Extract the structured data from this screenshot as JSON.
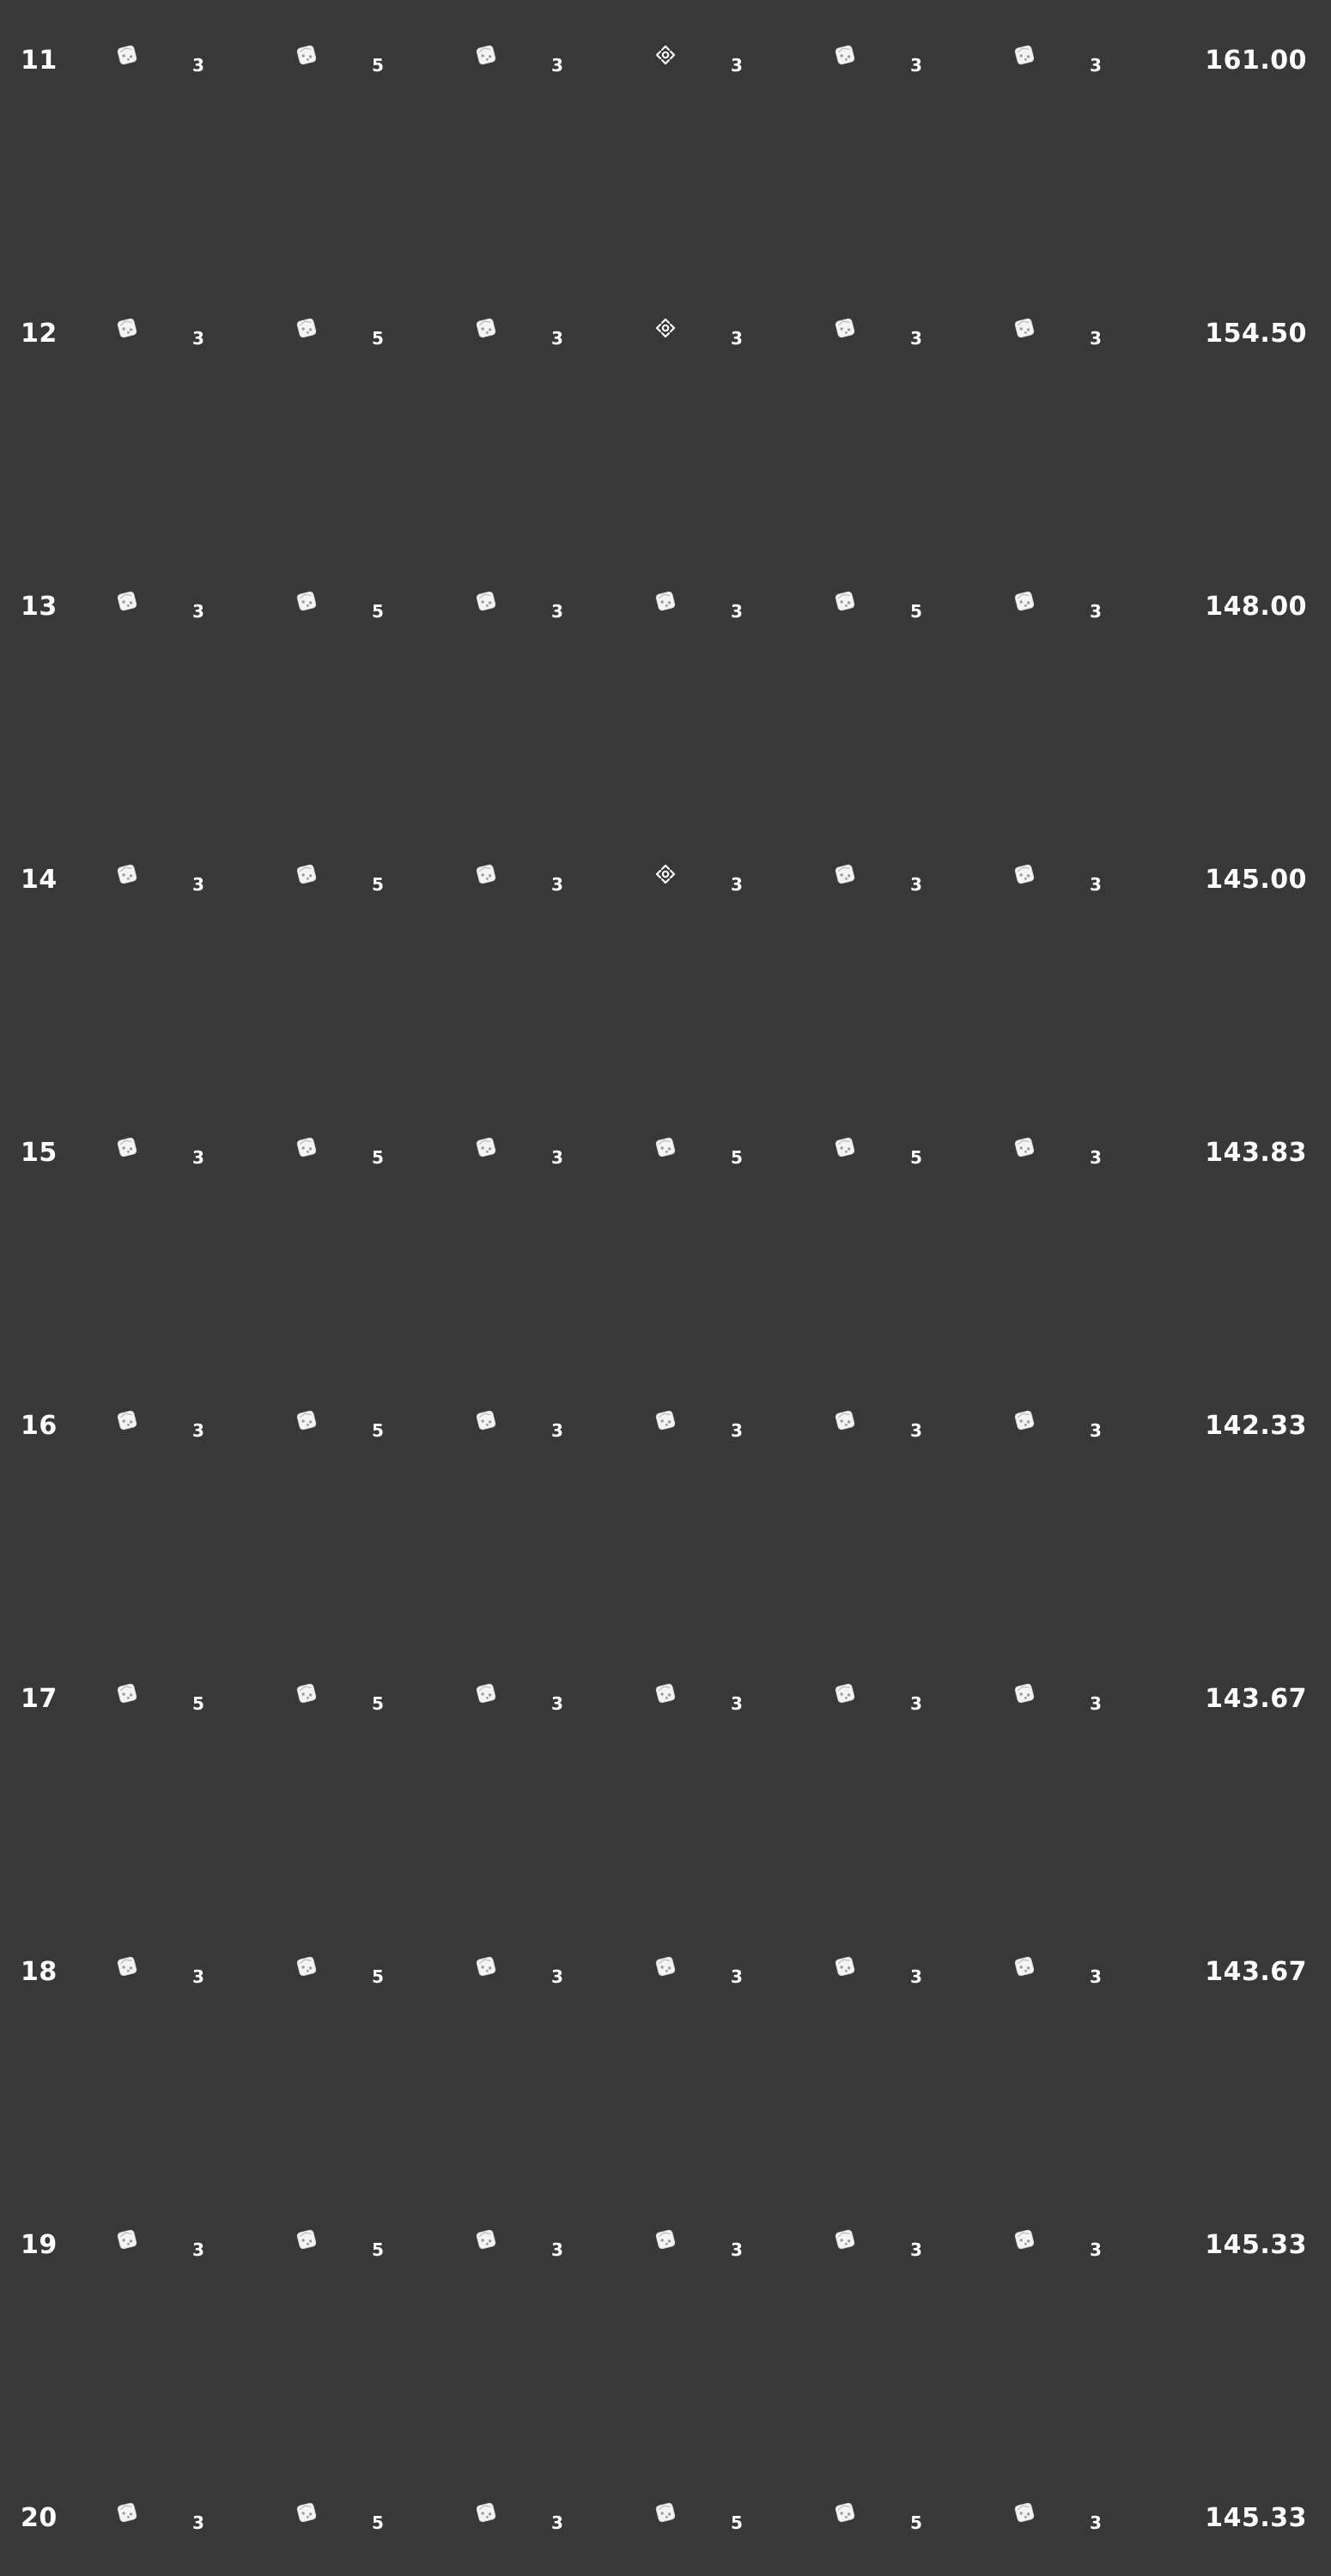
{
  "rows": [
    {
      "index": "11",
      "cells": [
        {
          "icon": "die-icon",
          "value": "3"
        },
        {
          "icon": "die-icon",
          "value": "5"
        },
        {
          "icon": "die-icon",
          "value": "3"
        },
        {
          "icon": "move-arrows-icon",
          "value": "3"
        },
        {
          "icon": "die-icon",
          "value": "3"
        },
        {
          "icon": "die-icon",
          "value": "3"
        }
      ],
      "total": "161.00"
    },
    {
      "index": "12",
      "cells": [
        {
          "icon": "die-icon",
          "value": "3"
        },
        {
          "icon": "die-icon",
          "value": "5"
        },
        {
          "icon": "die-icon",
          "value": "3"
        },
        {
          "icon": "move-arrows-icon",
          "value": "3"
        },
        {
          "icon": "die-icon",
          "value": "3"
        },
        {
          "icon": "die-icon",
          "value": "3"
        }
      ],
      "total": "154.50"
    },
    {
      "index": "13",
      "cells": [
        {
          "icon": "die-icon",
          "value": "3"
        },
        {
          "icon": "die-icon",
          "value": "5"
        },
        {
          "icon": "die-icon",
          "value": "3"
        },
        {
          "icon": "die-icon",
          "value": "3"
        },
        {
          "icon": "die-icon",
          "value": "5"
        },
        {
          "icon": "die-icon",
          "value": "3"
        }
      ],
      "total": "148.00"
    },
    {
      "index": "14",
      "cells": [
        {
          "icon": "die-icon",
          "value": "3"
        },
        {
          "icon": "die-icon",
          "value": "5"
        },
        {
          "icon": "die-icon",
          "value": "3"
        },
        {
          "icon": "move-arrows-icon",
          "value": "3"
        },
        {
          "icon": "die-icon",
          "value": "3"
        },
        {
          "icon": "die-icon",
          "value": "3"
        }
      ],
      "total": "145.00"
    },
    {
      "index": "15",
      "cells": [
        {
          "icon": "die-icon",
          "value": "3"
        },
        {
          "icon": "die-icon",
          "value": "5"
        },
        {
          "icon": "die-icon",
          "value": "3"
        },
        {
          "icon": "die-icon",
          "value": "5"
        },
        {
          "icon": "die-icon",
          "value": "5"
        },
        {
          "icon": "die-icon",
          "value": "3"
        }
      ],
      "total": "143.83"
    },
    {
      "index": "16",
      "cells": [
        {
          "icon": "die-icon",
          "value": "3"
        },
        {
          "icon": "die-icon",
          "value": "5"
        },
        {
          "icon": "die-icon",
          "value": "3"
        },
        {
          "icon": "die-icon",
          "value": "3"
        },
        {
          "icon": "die-icon",
          "value": "3"
        },
        {
          "icon": "die-icon",
          "value": "3"
        }
      ],
      "total": "142.33"
    },
    {
      "index": "17",
      "cells": [
        {
          "icon": "die-icon",
          "value": "5"
        },
        {
          "icon": "die-icon",
          "value": "5"
        },
        {
          "icon": "die-icon",
          "value": "3"
        },
        {
          "icon": "die-icon",
          "value": "3"
        },
        {
          "icon": "die-icon",
          "value": "3"
        },
        {
          "icon": "die-icon",
          "value": "3"
        }
      ],
      "total": "143.67"
    },
    {
      "index": "18",
      "cells": [
        {
          "icon": "die-icon",
          "value": "3"
        },
        {
          "icon": "die-icon",
          "value": "5"
        },
        {
          "icon": "die-icon",
          "value": "3"
        },
        {
          "icon": "die-icon",
          "value": "3"
        },
        {
          "icon": "die-icon",
          "value": "3"
        },
        {
          "icon": "die-icon",
          "value": "3"
        }
      ],
      "total": "143.67"
    },
    {
      "index": "19",
      "cells": [
        {
          "icon": "die-icon",
          "value": "3"
        },
        {
          "icon": "die-icon",
          "value": "5"
        },
        {
          "icon": "die-icon",
          "value": "3"
        },
        {
          "icon": "die-icon",
          "value": "3"
        },
        {
          "icon": "die-icon",
          "value": "3"
        },
        {
          "icon": "die-icon",
          "value": "3"
        }
      ],
      "total": "145.33"
    },
    {
      "index": "20",
      "cells": [
        {
          "icon": "die-icon",
          "value": "3"
        },
        {
          "icon": "die-icon",
          "value": "5"
        },
        {
          "icon": "die-icon",
          "value": "3"
        },
        {
          "icon": "die-icon",
          "value": "5"
        },
        {
          "icon": "die-icon",
          "value": "5"
        },
        {
          "icon": "die-icon",
          "value": "3"
        }
      ],
      "total": "145.33"
    }
  ]
}
